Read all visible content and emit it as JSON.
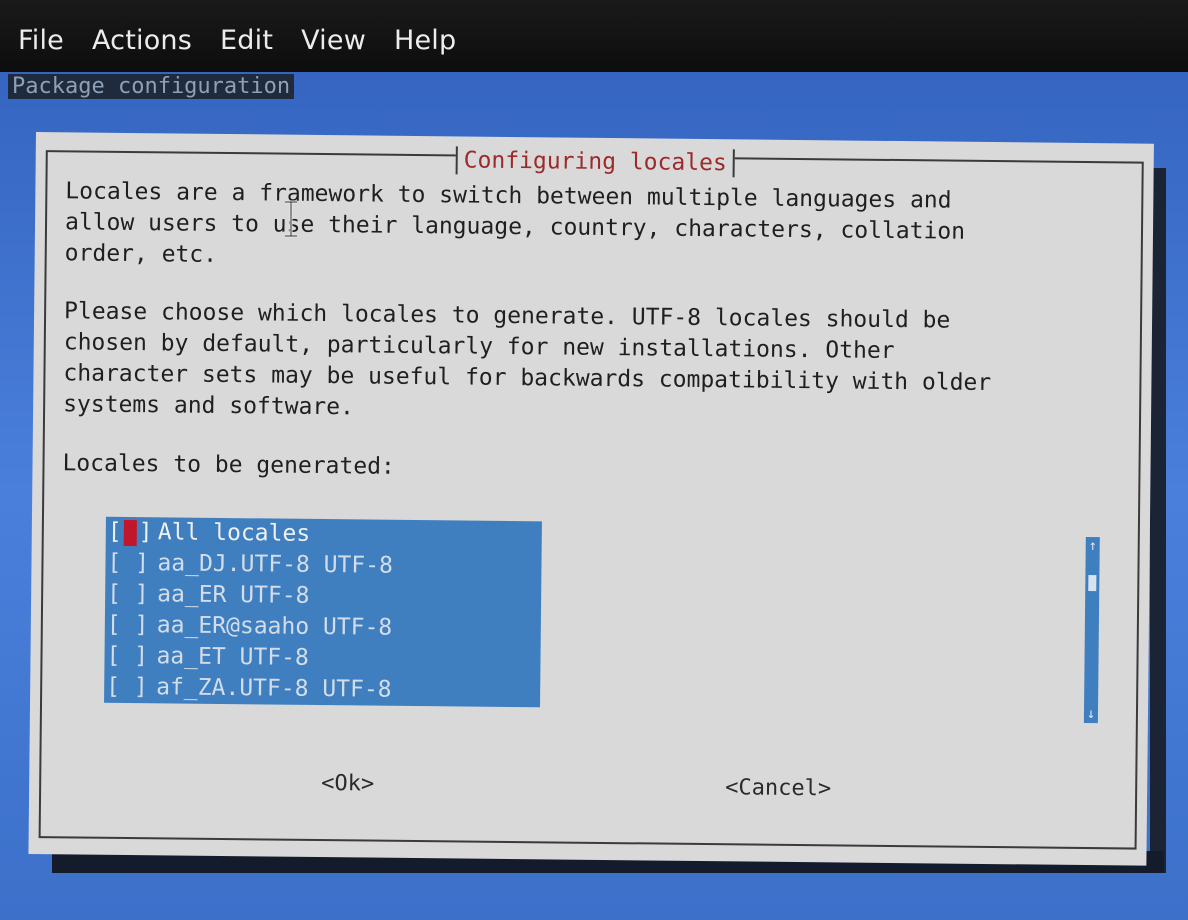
{
  "menubar": {
    "items": [
      "File",
      "Actions",
      "Edit",
      "View",
      "Help"
    ]
  },
  "terminal": {
    "title": "Package configuration"
  },
  "dialog": {
    "title": "Configuring locales",
    "paragraph1": "Locales are a framework to switch between multiple languages and\nallow users to use their language, country, characters, collation\norder, etc.",
    "paragraph2": "Please choose which locales to generate. UTF-8 locales should be\nchosen by default, particularly for new installations. Other\ncharacter sets may be useful for backwards compatibility with older\nsystems and software.",
    "prompt": "Locales to be generated:",
    "checkbox_empty": "[ ]",
    "locales": [
      "All locales",
      "aa_DJ.UTF-8 UTF-8",
      "aa_ER UTF-8",
      "aa_ER@saaho UTF-8",
      "aa_ET UTF-8",
      "af_ZA.UTF-8 UTF-8"
    ],
    "ok_label": "<Ok>",
    "cancel_label": "<Cancel>"
  },
  "scrollbar": {
    "up_icon": "arrow-up-icon",
    "down_icon": "arrow-down-icon"
  },
  "colors": {
    "list_bg": "#3f7fc0",
    "dialog_bg": "#d9d9d9",
    "title": "#9c2a2a",
    "cursor": "#c0182a",
    "terminal_bg": "#3a6fc9"
  }
}
